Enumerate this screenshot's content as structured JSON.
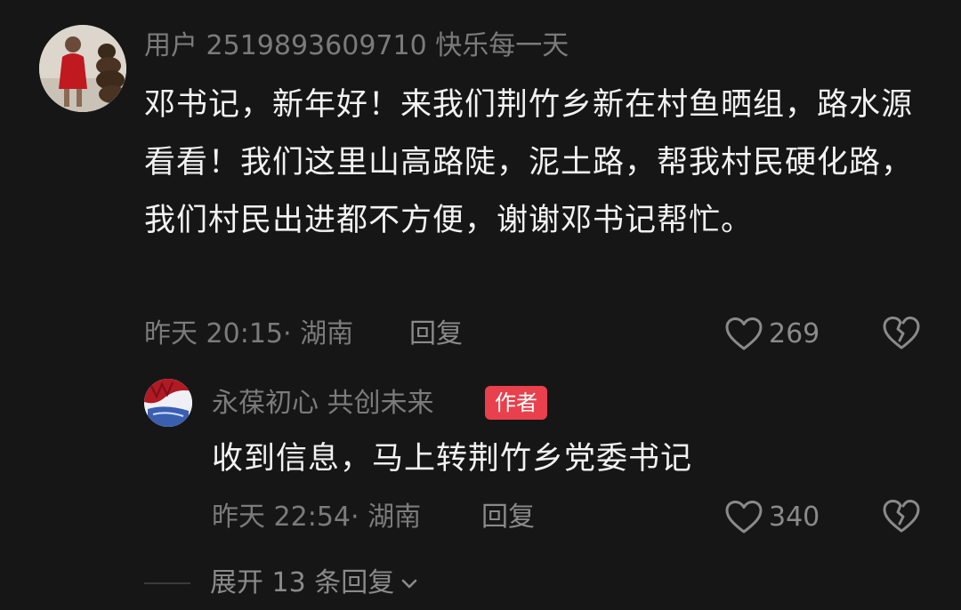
{
  "comment": {
    "username": "用户 2519893609710 快乐每一天",
    "text": "邓书记，新年好！来我们荆竹乡新在村鱼晒组，路水源看看！我们这里山高路陡，泥土路，帮我村民硬化路，我们村民出进都不方便，谢谢邓书记帮忙。",
    "time": "昨天 20:15",
    "location": "湖南",
    "reply_label": "回复",
    "like_count": "269"
  },
  "reply": {
    "username": "永葆初心  共创未来",
    "badge": "作者",
    "text": "收到信息，马上转荆竹乡党委书记",
    "time": "昨天 22:54",
    "location": "湖南",
    "reply_label": "回复",
    "like_count": "340"
  },
  "expand": {
    "label": "展开 13 条回复"
  },
  "colors": {
    "background": "#161616",
    "badge": "#e8404c",
    "meta_text": "#7b7b7b"
  },
  "icons": [
    "heart-outline-icon",
    "broken-heart-icon",
    "chevron-down-icon"
  ]
}
